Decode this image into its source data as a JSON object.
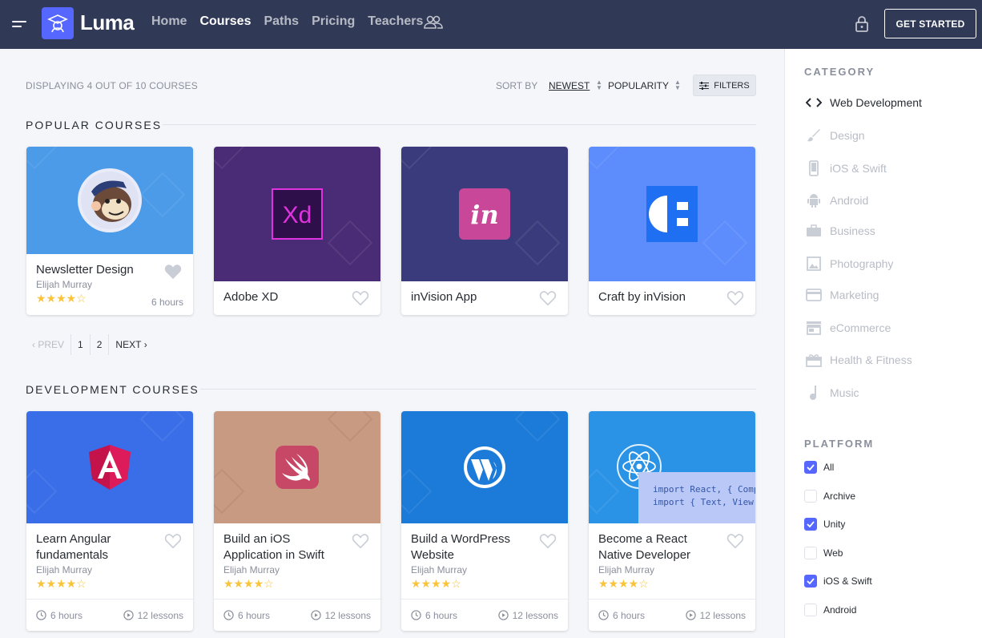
{
  "header": {
    "brand": "Luma",
    "nav": [
      "Home",
      "Courses",
      "Paths",
      "Pricing",
      "Teachers"
    ],
    "active_nav": "Courses",
    "cta": "GET STARTED"
  },
  "toolbar": {
    "displaying": "DISPLAYING 4 OUT OF 10 COURSES",
    "sort_by": "SORT BY",
    "sort_newest": "NEWEST",
    "sort_popularity": "POPULARITY",
    "filters": "FILTERS"
  },
  "popular": {
    "title": "POPULAR COURSES",
    "cards": [
      {
        "title": "Newsletter Design",
        "author": "Elijah Murray",
        "rating": 4,
        "hours": "6 hours",
        "color": "#4b9be9"
      },
      {
        "title": "Adobe XD",
        "color": "#4a2b75"
      },
      {
        "title": "inVision App",
        "color": "#3a3b7c"
      },
      {
        "title": "Craft by inVision",
        "color": "#5d8dfc"
      }
    ]
  },
  "pagination": {
    "prev": "PREV",
    "pages": [
      "1",
      "2"
    ],
    "next": "NEXT"
  },
  "development": {
    "title": "DEVELOPMENT COURSES",
    "cards": [
      {
        "title_line1": "Learn Angular",
        "title_line2": "fundamentals",
        "author": "Elijah Murray",
        "rating": 4,
        "hours": "6 hours",
        "lessons": "12 lessons",
        "color": "#3a6ee8"
      },
      {
        "title_line1": "Build an iOS",
        "title_line2": "Application in Swift",
        "author": "Elijah Murray",
        "rating": 4,
        "hours": "6 hours",
        "lessons": "12 lessons",
        "color": "#c89a81"
      },
      {
        "title_line1": "Build a WordPress",
        "title_line2": "Website",
        "author": "Elijah Murray",
        "rating": 4,
        "hours": "6 hours",
        "lessons": "12 lessons",
        "color": "#1c7ad8"
      },
      {
        "title_line1": "Become a React",
        "title_line2": "Native Developer",
        "author": "Elijah Murray",
        "rating": 4,
        "hours": "6 hours",
        "lessons": "12 lessons",
        "color": "#2b93e6",
        "code1": "import React, { Comp",
        "code2": "import { Text, View"
      }
    ]
  },
  "sidebar": {
    "category_title": "CATEGORY",
    "categories": [
      "Web Development",
      "Design",
      "iOS & Swift",
      "Android",
      "Business",
      "Photography",
      "Marketing",
      "eCommerce",
      "Health & Fitness",
      "Music"
    ],
    "active_category": "Web Development",
    "platform_title": "PLATFORM",
    "platforms": [
      {
        "label": "All",
        "checked": true
      },
      {
        "label": "Archive",
        "checked": false
      },
      {
        "label": "Unity",
        "checked": true
      },
      {
        "label": "Web",
        "checked": false
      },
      {
        "label": "iOS & Swift",
        "checked": true
      },
      {
        "label": "Android",
        "checked": false
      }
    ]
  }
}
